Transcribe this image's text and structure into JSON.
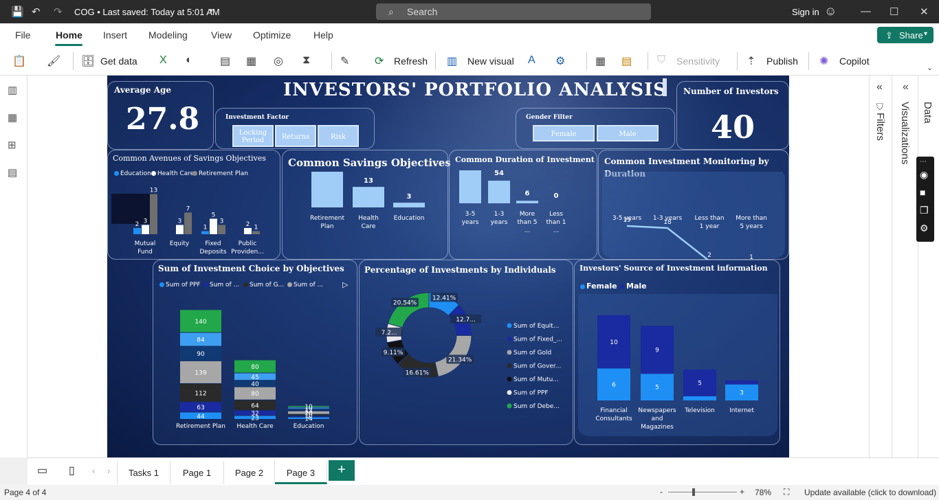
{
  "titlebar": {
    "doc_title": "COG • Last saved: Today at 5:01 AM",
    "search_placeholder": "Search",
    "signin": "Sign in"
  },
  "menu": {
    "items": [
      "File",
      "Home",
      "Insert",
      "Modeling",
      "View",
      "Optimize",
      "Help"
    ],
    "share": "Share"
  },
  "ribbon": {
    "get_data": "Get data",
    "refresh": "Refresh",
    "new_visual": "New visual",
    "sensitivity": "Sensitivity",
    "publish": "Publish",
    "copilot": "Copilot"
  },
  "report": {
    "title": "INVESTORS' PORTFOLIO ANALYSIS",
    "avg_age": {
      "label": "Average Age",
      "value": "27.8"
    },
    "num_investors": {
      "label": "Number of Investors",
      "value": "40"
    },
    "investment_factor": {
      "label": "Investment Factor",
      "buttons": [
        "Locking Period",
        "Returns",
        "Risk"
      ]
    },
    "gender_filter": {
      "label": "Gender Filter",
      "buttons": [
        "Female",
        "Male"
      ]
    }
  },
  "colors": {
    "accent": "#117865",
    "light_blue": "#9fcdf7",
    "grey": "#6f6f6f",
    "white": "#ffffff"
  },
  "chart_data": [
    {
      "type": "bar",
      "title": "Common Avenues of Savings Objectives",
      "categories": [
        "Mutual Fund",
        "Equity",
        "Fixed Deposits",
        "Public Providen..."
      ],
      "series": [
        {
          "name": "Education",
          "values": [
            2,
            null,
            1,
            null
          ]
        },
        {
          "name": "Health Care",
          "values": [
            3,
            3,
            5,
            2
          ]
        },
        {
          "name": "Retirement Plan",
          "values": [
            13,
            7,
            3,
            1
          ]
        }
      ]
    },
    {
      "type": "bar",
      "title": "Common Savings Objectives",
      "categories": [
        "Retirement Plan",
        "Health Care",
        "Education"
      ],
      "values": [
        24,
        13,
        3
      ]
    },
    {
      "type": "bar",
      "title": "Common Duration of Investment",
      "categories": [
        "3-5 years",
        "1-3 years",
        "More than 5 ...",
        "Less than 1 ..."
      ],
      "values": [
        95,
        54,
        6,
        0
      ]
    },
    {
      "type": "line",
      "title": "Common Investment Monitoring by Duration",
      "categories": [
        "3-5 years",
        "1-3 years",
        "Less than 1 year",
        "More than 5 years"
      ],
      "values": [
        19,
        18,
        2,
        1
      ]
    },
    {
      "type": "bar",
      "title": "Sum of Investment Choice by Objectives",
      "legend": [
        "Sum of PPF",
        "Sum of ...",
        "Sum of G...",
        "Sum of ..."
      ],
      "categories": [
        "Retirement Plan",
        "Health Care",
        "Education"
      ],
      "stacks": [
        {
          "values": [
            44,
            63,
            112,
            139,
            90,
            84,
            140
          ],
          "colors": [
            "#1e8ff5",
            "#1a2aa0",
            "#2a2a2a",
            "#a7a7a7",
            "#0f3a73",
            "#3e9ff0",
            "#22a84a"
          ]
        },
        {
          "values": [
            23,
            32,
            64,
            80,
            40,
            45,
            80
          ],
          "colors": [
            "#1e8ff5",
            "#1a2aa0",
            "#2a2a2a",
            "#a7a7a7",
            "#0f3a73",
            "#3e9ff0",
            "#22a84a"
          ]
        },
        {
          "values": [
            14,
            7,
            10,
            20,
            13,
            10,
            10
          ],
          "colors": [
            "#1e8ff5",
            "#1a2aa0",
            "#2a2a2a",
            "#a7a7a7",
            "#0f3a73",
            "#3e9ff0",
            "#22a84a"
          ]
        }
      ]
    },
    {
      "type": "pie",
      "title": "Percentage of Investments by Individuals",
      "labels": [
        "12.41%",
        "12.7...",
        "21.34%",
        "16.61%",
        "9.11%",
        "7.2...",
        "20.54%"
      ],
      "values": [
        12.41,
        12.7,
        21.34,
        16.61,
        9.11,
        7.2,
        20.54
      ],
      "legend": [
        "Sum of Equit...",
        "Sum of Fixed_...",
        "Sum of Gold",
        "Sum of Gover...",
        "Sum of Mutu...",
        "Sum of PPF",
        "Sum of Debe..."
      ]
    },
    {
      "type": "bar",
      "title": "Investors' Source of Investment information",
      "categories": [
        "Financial Consultants",
        "Newspapers and Magazines",
        "Television",
        "Internet"
      ],
      "series": [
        {
          "name": "Female",
          "values": [
            6,
            5,
            null,
            3
          ]
        },
        {
          "name": "Male",
          "values": [
            10,
            9,
            5,
            null
          ]
        }
      ]
    }
  ],
  "pages": {
    "tabs": [
      "Tasks 1",
      "Page 1",
      "Page 2",
      "Page 3"
    ],
    "add": "+"
  },
  "right": {
    "filters": "Filters",
    "visualizations": "Visualizations",
    "data": "Data"
  },
  "status": {
    "page": "Page 4 of 4",
    "zoom": "78%",
    "update": "Update available (click to download)"
  }
}
